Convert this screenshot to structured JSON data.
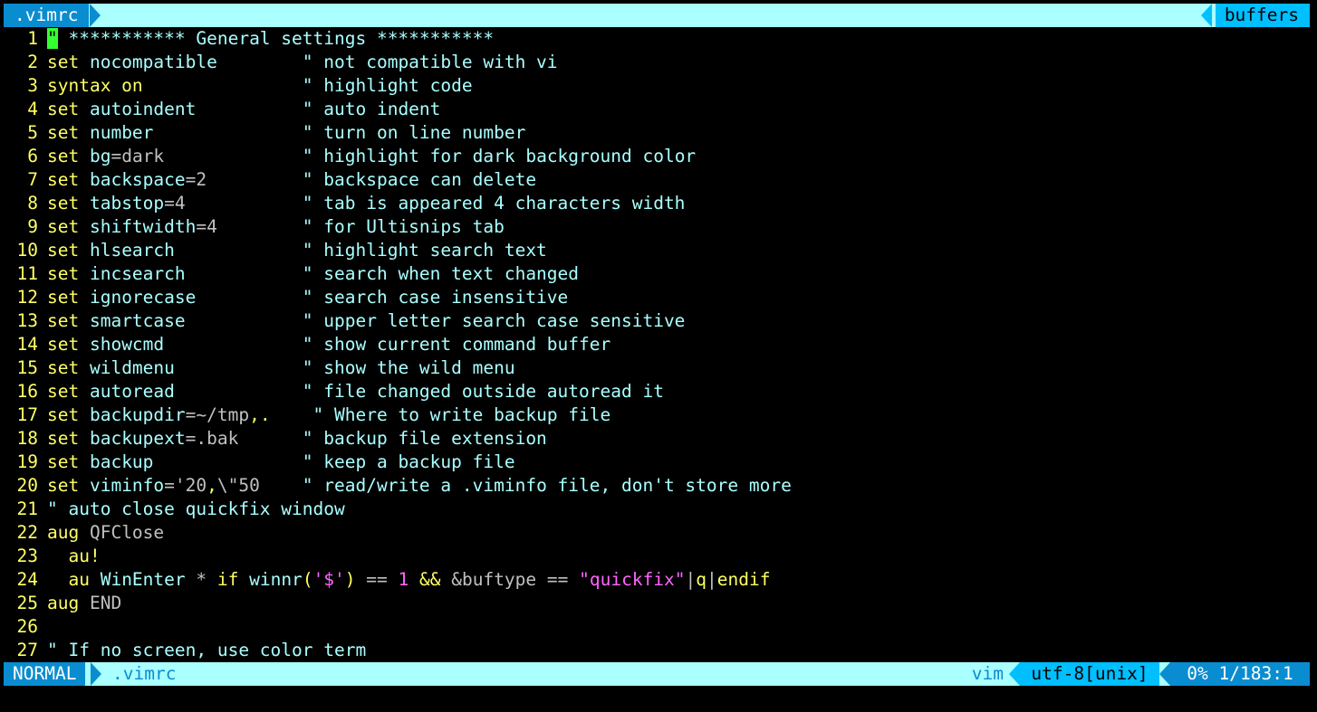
{
  "tabline": {
    "active_tab": ".vimrc",
    "right_label": "buffers"
  },
  "lines": [
    {
      "n": "1",
      "segs": [
        {
          "c": "cursor",
          "t": "\""
        },
        {
          "c": "cmt",
          "t": " *********** General settings ***********"
        }
      ]
    },
    {
      "n": "2",
      "segs": [
        {
          "c": "kw",
          "t": "set"
        },
        {
          "c": "cmt",
          "t": " nocompatible        "
        },
        {
          "c": "cmt",
          "t": "\" not compatible with vi"
        }
      ]
    },
    {
      "n": "3",
      "segs": [
        {
          "c": "kw",
          "t": "syntax on"
        },
        {
          "c": "cmt",
          "t": "               "
        },
        {
          "c": "cmt",
          "t": "\" highlight code"
        }
      ]
    },
    {
      "n": "4",
      "segs": [
        {
          "c": "kw",
          "t": "set"
        },
        {
          "c": "cmt",
          "t": " autoindent          "
        },
        {
          "c": "cmt",
          "t": "\" auto indent"
        }
      ]
    },
    {
      "n": "5",
      "segs": [
        {
          "c": "kw",
          "t": "set"
        },
        {
          "c": "cmt",
          "t": " number              "
        },
        {
          "c": "cmt",
          "t": "\" turn on line number"
        }
      ]
    },
    {
      "n": "6",
      "segs": [
        {
          "c": "kw",
          "t": "set"
        },
        {
          "c": "cmt",
          "t": " bg"
        },
        {
          "c": "val",
          "t": "=dark             "
        },
        {
          "c": "cmt",
          "t": "\" highlight for dark background color"
        }
      ]
    },
    {
      "n": "7",
      "segs": [
        {
          "c": "kw",
          "t": "set"
        },
        {
          "c": "cmt",
          "t": " backspace"
        },
        {
          "c": "val",
          "t": "=2         "
        },
        {
          "c": "cmt",
          "t": "\" backspace can delete"
        }
      ]
    },
    {
      "n": "8",
      "segs": [
        {
          "c": "kw",
          "t": "set"
        },
        {
          "c": "cmt",
          "t": " tabstop"
        },
        {
          "c": "val",
          "t": "=4           "
        },
        {
          "c": "cmt",
          "t": "\" tab is appeared 4 characters width"
        }
      ]
    },
    {
      "n": "9",
      "segs": [
        {
          "c": "kw",
          "t": "set"
        },
        {
          "c": "cmt",
          "t": " shiftwidth"
        },
        {
          "c": "val",
          "t": "=4        "
        },
        {
          "c": "cmt",
          "t": "\" for Ultisnips tab"
        }
      ]
    },
    {
      "n": "10",
      "segs": [
        {
          "c": "kw",
          "t": "set"
        },
        {
          "c": "cmt",
          "t": " hlsearch            "
        },
        {
          "c": "cmt",
          "t": "\" highlight search text"
        }
      ]
    },
    {
      "n": "11",
      "segs": [
        {
          "c": "kw",
          "t": "set"
        },
        {
          "c": "cmt",
          "t": " incsearch           "
        },
        {
          "c": "cmt",
          "t": "\" search when text changed"
        }
      ]
    },
    {
      "n": "12",
      "segs": [
        {
          "c": "kw",
          "t": "set"
        },
        {
          "c": "cmt",
          "t": " ignorecase          "
        },
        {
          "c": "cmt",
          "t": "\" search case insensitive"
        }
      ]
    },
    {
      "n": "13",
      "segs": [
        {
          "c": "kw",
          "t": "set"
        },
        {
          "c": "cmt",
          "t": " smartcase           "
        },
        {
          "c": "cmt",
          "t": "\" upper letter search case sensitive"
        }
      ]
    },
    {
      "n": "14",
      "segs": [
        {
          "c": "kw",
          "t": "set"
        },
        {
          "c": "cmt",
          "t": " showcmd             "
        },
        {
          "c": "cmt",
          "t": "\" show current command buffer"
        }
      ]
    },
    {
      "n": "15",
      "segs": [
        {
          "c": "kw",
          "t": "set"
        },
        {
          "c": "cmt",
          "t": " wildmenu            "
        },
        {
          "c": "cmt",
          "t": "\" show the wild menu"
        }
      ]
    },
    {
      "n": "16",
      "segs": [
        {
          "c": "kw",
          "t": "set"
        },
        {
          "c": "cmt",
          "t": " autoread            "
        },
        {
          "c": "cmt",
          "t": "\" file changed outside autoread it"
        }
      ]
    },
    {
      "n": "17",
      "segs": [
        {
          "c": "kw",
          "t": "set"
        },
        {
          "c": "cmt",
          "t": " backupdir"
        },
        {
          "c": "val",
          "t": "=~/tmp"
        },
        {
          "c": "op",
          "t": ",."
        },
        {
          "c": "cmt",
          "t": "    "
        },
        {
          "c": "cmt",
          "t": "\" Where to write backup file"
        }
      ]
    },
    {
      "n": "18",
      "segs": [
        {
          "c": "kw",
          "t": "set"
        },
        {
          "c": "cmt",
          "t": " backupext"
        },
        {
          "c": "val",
          "t": "=.bak      "
        },
        {
          "c": "cmt",
          "t": "\" backup file extension"
        }
      ]
    },
    {
      "n": "19",
      "segs": [
        {
          "c": "kw",
          "t": "set"
        },
        {
          "c": "cmt",
          "t": " backup              "
        },
        {
          "c": "cmt",
          "t": "\" keep a backup file"
        }
      ]
    },
    {
      "n": "20",
      "segs": [
        {
          "c": "kw",
          "t": "set"
        },
        {
          "c": "cmt",
          "t": " viminfo"
        },
        {
          "c": "val",
          "t": "='20"
        },
        {
          "c": "op",
          "t": ","
        },
        {
          "c": "val",
          "t": "\\\"50    "
        },
        {
          "c": "cmt",
          "t": "\" read/write a .viminfo file, don't store more"
        }
      ]
    },
    {
      "n": "21",
      "segs": [
        {
          "c": "cmt",
          "t": "\" auto close quickfix window"
        }
      ]
    },
    {
      "n": "22",
      "segs": [
        {
          "c": "kw",
          "t": "aug"
        },
        {
          "c": "val",
          "t": " QFClose"
        }
      ]
    },
    {
      "n": "23",
      "segs": [
        {
          "c": "kw",
          "t": "  au!"
        }
      ]
    },
    {
      "n": "24",
      "segs": [
        {
          "c": "kw",
          "t": "  au"
        },
        {
          "c": "cmt",
          "t": " WinEnter"
        },
        {
          "c": "val",
          "t": " * "
        },
        {
          "c": "kw",
          "t": "if"
        },
        {
          "c": "cmt",
          "t": " winnr"
        },
        {
          "c": "op",
          "t": "("
        },
        {
          "c": "str",
          "t": "'$'"
        },
        {
          "c": "op",
          "t": ")"
        },
        {
          "c": "val",
          "t": " == "
        },
        {
          "c": "str",
          "t": "1"
        },
        {
          "c": "op",
          "t": " && "
        },
        {
          "c": "val",
          "t": "&buftype == "
        },
        {
          "c": "str",
          "t": "\"quickfix\""
        },
        {
          "c": "val",
          "t": "|"
        },
        {
          "c": "kw",
          "t": "q"
        },
        {
          "c": "val",
          "t": "|"
        },
        {
          "c": "kw",
          "t": "endif"
        }
      ]
    },
    {
      "n": "25",
      "segs": [
        {
          "c": "kw",
          "t": "aug"
        },
        {
          "c": "val",
          "t": " END"
        }
      ]
    },
    {
      "n": "26",
      "segs": []
    },
    {
      "n": "27",
      "segs": [
        {
          "c": "cmt",
          "t": "\" If no screen, use color term"
        }
      ]
    }
  ],
  "status": {
    "mode": "NORMAL",
    "filename": ".vimrc",
    "filetype": "vim",
    "encoding": "utf-8[unix]",
    "position": "0% 1/183:1"
  },
  "colors": {
    "tab_bg": "#aaffff",
    "accent_blue": "#0a8dd0",
    "bright_blue": "#00bfff",
    "line_number": "#ffff66",
    "cursor": "#33ff33"
  }
}
